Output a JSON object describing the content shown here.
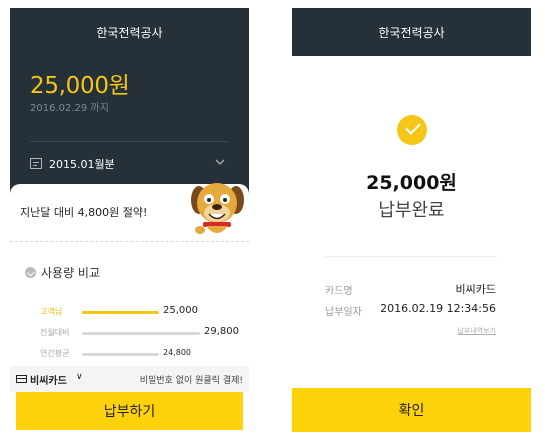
{
  "left_screen": {
    "header_title": "한국전력공사",
    "amount": "25,000원",
    "due_date": "2016.02.29 까지",
    "month_selector": "2015.01월분",
    "savings_message": "지난달 대비 4,800원 절약!",
    "usage_section_title": "사용량 비교",
    "usage_comparison": [
      {
        "label": "고객님",
        "value": "25,000",
        "amount": 25000,
        "highlight": true
      },
      {
        "label": "전월대비",
        "value": "29,800",
        "amount": 29800,
        "highlight": false
      },
      {
        "label": "연간평균",
        "value": "24,800",
        "amount": 24800,
        "highlight": false
      }
    ],
    "card_name": "비씨카드",
    "card_caret": "∨",
    "card_promo": "비밀번호 없이 원클릭 결제!",
    "pay_button": "납부하기"
  },
  "right_screen": {
    "header_title": "한국전력공사",
    "amount": "25,000원",
    "status": "납부완료",
    "card_label": "카드명",
    "card_value": "비씨카드",
    "date_label": "납부일자",
    "date_value": "2016.02.19 12:34:56",
    "history_link": "납부내역보기",
    "confirm_button": "확인"
  },
  "colors": {
    "header_bg": "#253039",
    "accent_yellow": "#fdd20a",
    "amount_yellow": "#f5c518"
  },
  "icons": [
    "calendar-icon",
    "chevron-down-icon",
    "check-circle-icon",
    "card-icon",
    "mascot-dog"
  ]
}
